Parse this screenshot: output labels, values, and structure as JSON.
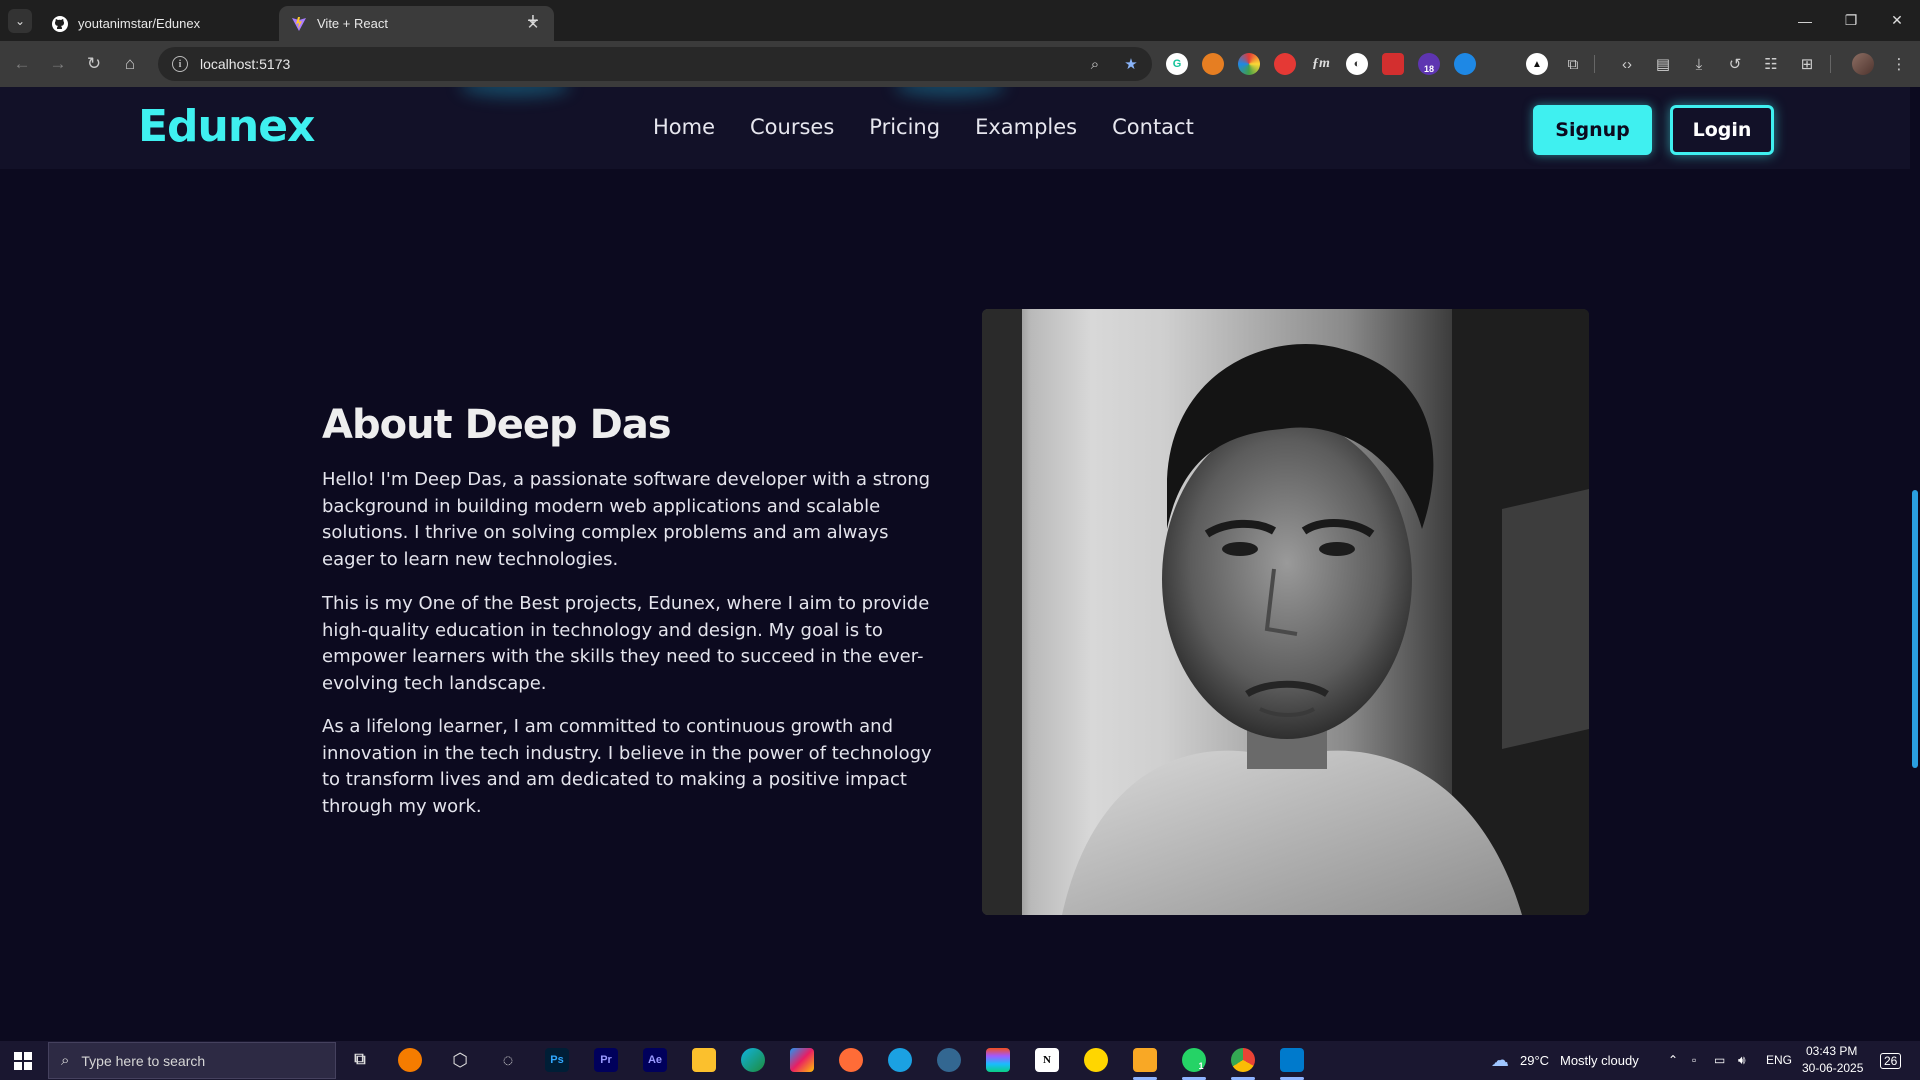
{
  "browser": {
    "tabs": [
      {
        "title": "youtanimstar/Edunex",
        "favicon": "github-icon",
        "active": false
      },
      {
        "title": "Vite + React",
        "favicon": "vite-icon",
        "active": true
      }
    ],
    "new_tab_symbol": "+",
    "address": "localhost:5173",
    "extension_badge": "18"
  },
  "site": {
    "logo": "Edunex",
    "nav": [
      "Home",
      "Courses",
      "Pricing",
      "Examples",
      "Contact"
    ],
    "signup_label": "Signup",
    "login_label": "Login",
    "accent_color": "#3ff0f0",
    "background_color": "#0c0a1f"
  },
  "about": {
    "title": "About Deep Das",
    "paragraphs": [
      "Hello! I'm Deep Das, a passionate software developer with a strong background in building modern web applications and scalable solutions. I thrive on solving complex problems and am always eager to learn new technologies.",
      "This is my One of the Best projects, Edunex, where I aim to provide high-quality education in technology and design. My goal is to empower learners with the skills they need to succeed in the ever-evolving tech landscape.",
      "As a lifelong learner, I am committed to continuous growth and innovation in the tech industry. I believe in the power of technology to transform lives and am dedicated to making a positive impact through my work."
    ],
    "photo_icon": "portrait-photo"
  },
  "taskbar": {
    "search_placeholder": "Type here to search",
    "weather_temp": "29°C",
    "weather_text": "Mostly cloudy",
    "language": "ENG",
    "time": "03:43 PM",
    "date": "30-06-2025",
    "notification_count": "26",
    "whatsapp_badge": "1",
    "app_labels": {
      "photoshop": "Ps",
      "premiere": "Pr",
      "after_effects": "Ae",
      "notion": "N"
    }
  }
}
